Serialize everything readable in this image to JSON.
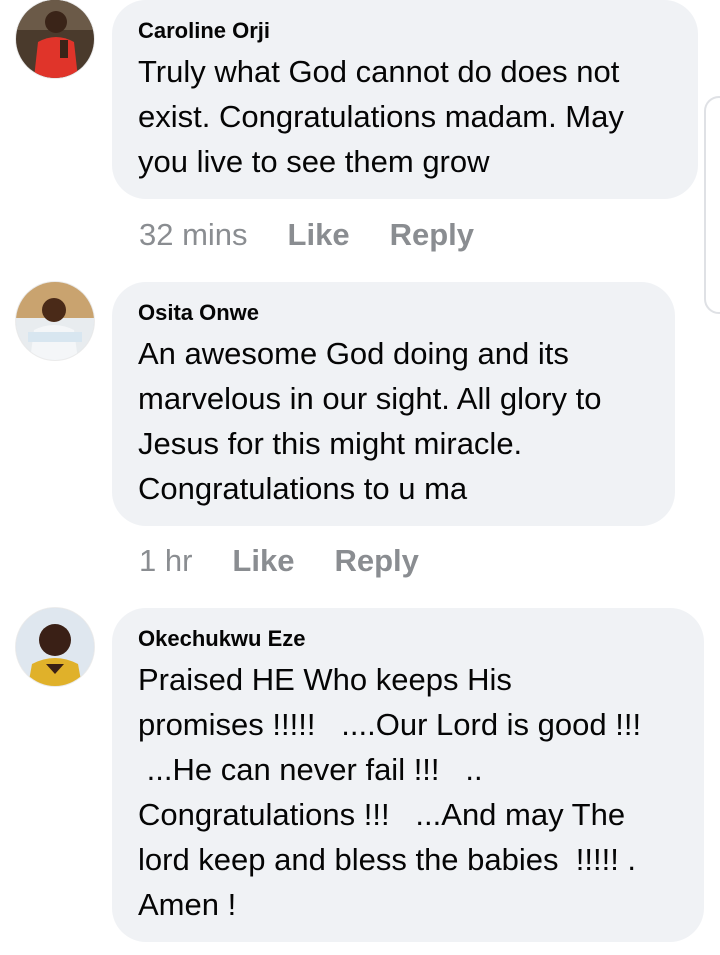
{
  "comments": [
    {
      "author": "Caroline Orji",
      "text": "Truly what God cannot do does not\nexist. Congratulations madam. May\nyou live to see them grow",
      "time": "32 mins",
      "like_label": "Like",
      "reply_label": "Reply"
    },
    {
      "author": "Osita Onwe",
      "text": "An awesome God doing and its\nmarvelous in our sight. All glory to\nJesus for this might miracle.\nCongratulations to u ma",
      "time": "1 hr",
      "like_label": "Like",
      "reply_label": "Reply"
    },
    {
      "author": "Okechukwu Eze",
      "text": "Praised HE Who keeps His\npromises !!!!!   ....Our Lord is good !!!\n ...He can never fail !!!   ..\nCongratulations !!!   ...And may The\nlord keep and bless the babies  !!!!! .\nAmen !",
      "time": "",
      "like_label": "",
      "reply_label": ""
    }
  ],
  "colors": {
    "bubble_bg": "#f0f2f5",
    "meta_text": "#8a8d91",
    "body_text": "#050505"
  }
}
